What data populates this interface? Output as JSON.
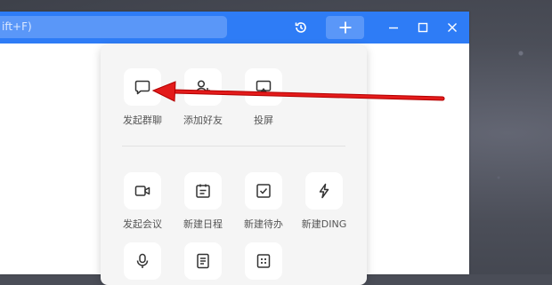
{
  "search": {
    "text": "ift+F)"
  },
  "menu": {
    "row1": [
      {
        "label": "发起群聊",
        "icon": "chat-bubble-icon"
      },
      {
        "label": "添加好友",
        "icon": "add-user-icon"
      },
      {
        "label": "投屏",
        "icon": "screen-cast-icon"
      }
    ],
    "row2": [
      {
        "label": "发起会议",
        "icon": "video-camera-icon"
      },
      {
        "label": "新建日程",
        "icon": "calendar-icon"
      },
      {
        "label": "新建待办",
        "icon": "checkbox-icon"
      },
      {
        "label": "新建DING",
        "icon": "lightning-icon"
      }
    ],
    "row3": [
      {
        "icon": "voice-icon"
      },
      {
        "icon": "document-icon"
      },
      {
        "icon": "sheet-icon"
      }
    ]
  },
  "colors": {
    "accent": "#2e7cf6",
    "annotation_arrow": "#e31b1b"
  }
}
